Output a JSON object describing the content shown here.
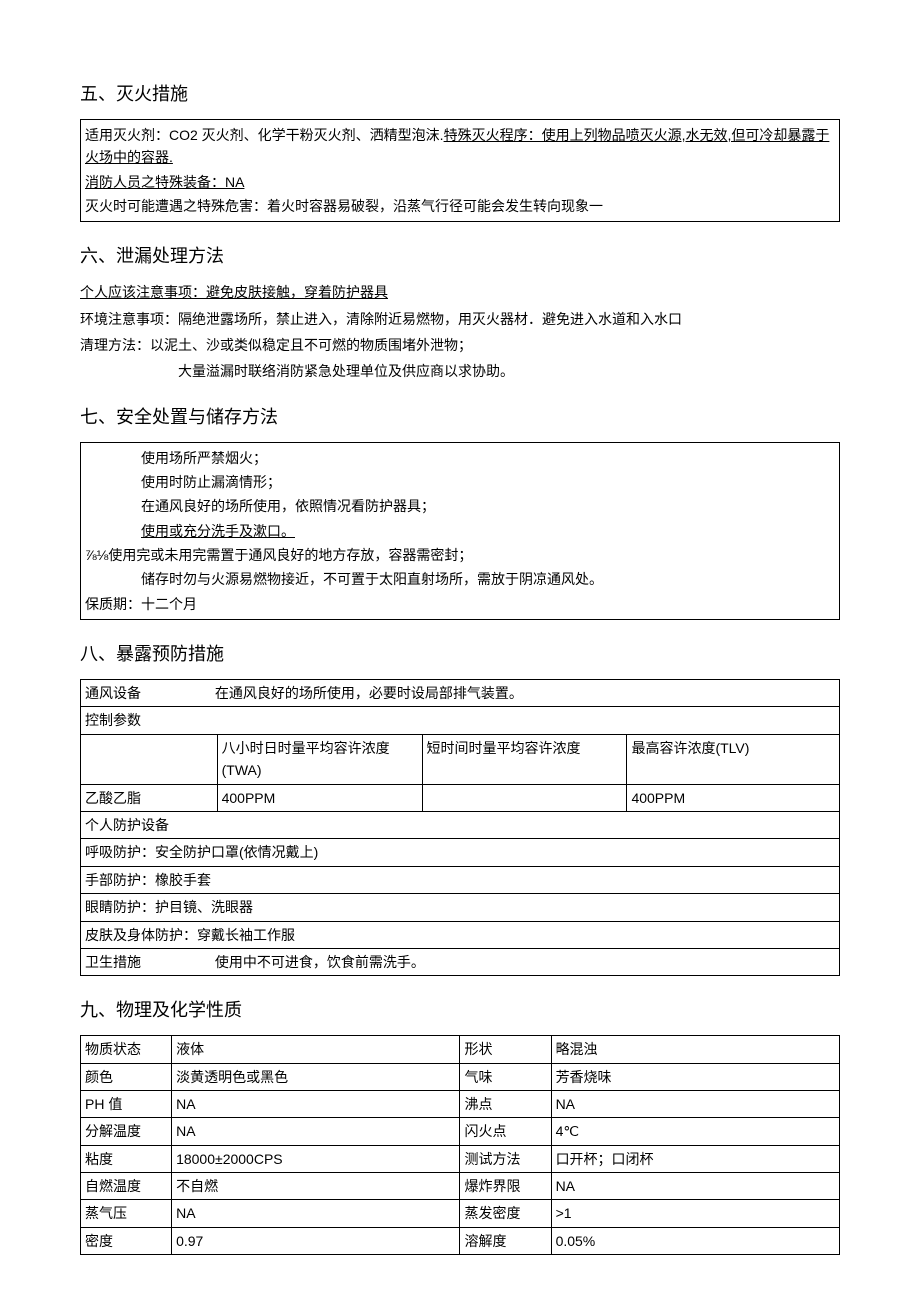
{
  "s5": {
    "title": "五、灭火措施",
    "l1a": "适用灭火剂：CO2 灭火剂、化学干粉灭火剂、洒精型泡沫.",
    "l1b": "特殊灭火程序：使用上列物品喷灭火源,水无效,但可冷却暴露于火场中的容器.",
    "l2": "消防人员之特殊装备：NA",
    "l3": "灭火时可能遭遇之特殊危害：着火时容器易破裂，沿蒸气行径可能会发生转向现象一"
  },
  "s6": {
    "title": "六、泄漏处理方法",
    "l1": "个人应该注意事项：避免皮肤接触，穿着防护器具",
    "l2": "环境注意事项：隔绝泄露场所，禁止进入，清除附近易燃物，用灭火器材．避免进入水道和入水口",
    "l3": "清理方法：以泥土、沙或类似稳定且不可燃的物质围堵外泄物；",
    "l4": "大量溢漏时联络消防紧急处理单位及供应商以求协助。"
  },
  "s7": {
    "title": "七、安全处置与储存方法",
    "l1": "使用场所严禁烟火；",
    "l2": "使用时防止漏滴情形；",
    "l3": "在通风良好的场所使用，依照情况看防护器具；",
    "l4": "使用或充分洗手及漱口。",
    "l5": "⅞⅛使用完或未用完需置于通风良好的地方存放，容器需密封；",
    "l6": "储存时勿与火源易燃物接近，不可置于太阳直射场所，需放于阴凉通风处。",
    "l7": "保质期：十二个月"
  },
  "s8": {
    "title": "八、暴露预防措施",
    "vent_label": "通风设备",
    "vent_val": "在通风良好的场所使用，必要时设局部排气装置。",
    "ctrl": "控制参数",
    "col1": "八小时日时量平均容许浓度(TWA)",
    "col2": "短时间时量平均容许浓度",
    "col3": "最高容许浓度(TLV)",
    "row_name": "乙酸乙脂",
    "row_v1": "400PPM",
    "row_v2": "",
    "row_v3": "400PPM",
    "ppe": "个人防护设备",
    "resp": "呼吸防护：安全防护口罩(依情况戴上)",
    "hand": "手部防护：橡胶手套",
    "eye": "眼睛防护：护目镜、洗眼器",
    "skin": "皮肤及身体防护：穿戴长袖工作服",
    "hyg_label": "卫生措施",
    "hyg_val": "使用中不可进食，饮食前需洗手。"
  },
  "s9": {
    "title": "九、物理及化学性质",
    "rows": [
      [
        "物质状态",
        "液体",
        "形状",
        "略混浊"
      ],
      [
        "颜色",
        "淡黄透明色或黑色",
        "气味",
        "芳香烧味"
      ],
      [
        "PH 值",
        "NA",
        "沸点",
        "NA"
      ],
      [
        "分解温度",
        "NA",
        "闪火点",
        "4℃"
      ],
      [
        "粘度",
        "18000±2000CPS",
        "测试方法",
        "口开杯；口闭杯"
      ],
      [
        "自燃温度",
        "不自燃",
        "爆炸界限",
        "NA"
      ],
      [
        "蒸气压",
        "NA",
        "蒸发密度",
        ">1"
      ],
      [
        "密度",
        "0.97",
        "溶解度",
        "0.05%"
      ]
    ]
  }
}
